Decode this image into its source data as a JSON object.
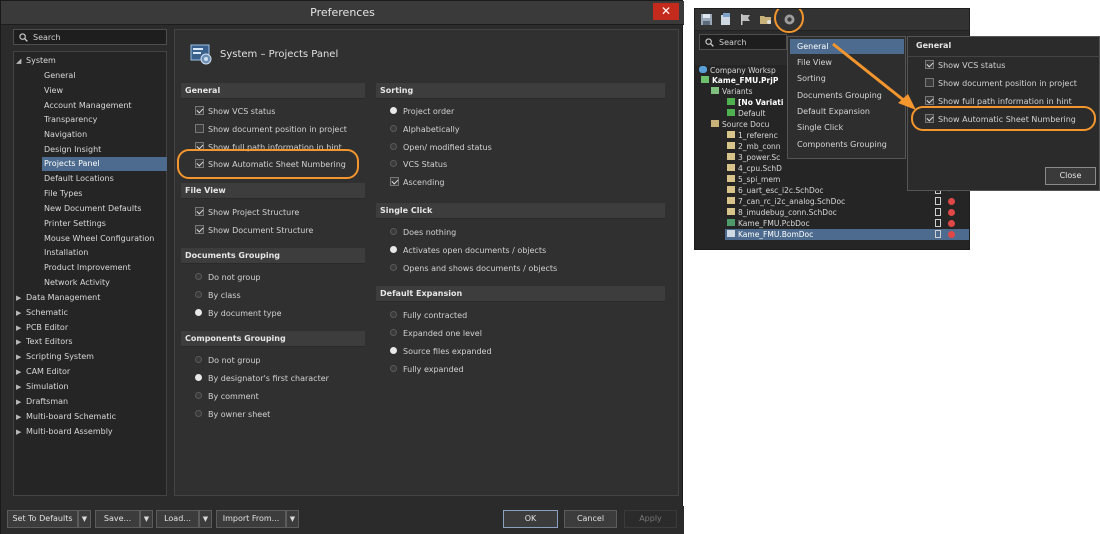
{
  "window": {
    "title": "Preferences",
    "close_glyph": "✕"
  },
  "search": {
    "placeholder": "Search",
    "icon": "search-icon"
  },
  "tree": [
    {
      "label": "System",
      "expanded": true,
      "level": 0
    },
    {
      "label": "General",
      "level": 1
    },
    {
      "label": "View",
      "level": 1
    },
    {
      "label": "Account Management",
      "level": 1
    },
    {
      "label": "Transparency",
      "level": 1
    },
    {
      "label": "Navigation",
      "level": 1
    },
    {
      "label": "Design Insight",
      "level": 1
    },
    {
      "label": "Projects Panel",
      "level": 1,
      "selected": true
    },
    {
      "label": "Default Locations",
      "level": 1
    },
    {
      "label": "File Types",
      "level": 1
    },
    {
      "label": "New Document Defaults",
      "level": 1
    },
    {
      "label": "Printer Settings",
      "level": 1
    },
    {
      "label": "Mouse Wheel Configuration",
      "level": 1
    },
    {
      "label": "Installation",
      "level": 1
    },
    {
      "label": "Product Improvement",
      "level": 1
    },
    {
      "label": "Network Activity",
      "level": 1
    },
    {
      "label": "Data Management",
      "level": 0
    },
    {
      "label": "Schematic",
      "level": 0
    },
    {
      "label": "PCB Editor",
      "level": 0
    },
    {
      "label": "Text Editors",
      "level": 0
    },
    {
      "label": "Scripting System",
      "level": 0
    },
    {
      "label": "CAM Editor",
      "level": 0
    },
    {
      "label": "Simulation",
      "level": 0
    },
    {
      "label": "Draftsman",
      "level": 0
    },
    {
      "label": "Multi-board Schematic",
      "level": 0
    },
    {
      "label": "Multi-board Assembly",
      "level": 0
    }
  ],
  "page": {
    "title": "System – Projects Panel",
    "general": {
      "header": "General",
      "options": [
        {
          "label": "Show VCS status",
          "checked": true
        },
        {
          "label": "Show document position in project",
          "checked": false
        },
        {
          "label": "Show full path information in hint",
          "checked": true
        },
        {
          "label": "Show Automatic Sheet Numbering",
          "checked": true
        }
      ]
    },
    "file_view": {
      "header": "File View",
      "options": [
        {
          "label": "Show Project Structure",
          "checked": true
        },
        {
          "label": "Show Document Structure",
          "checked": true
        }
      ]
    },
    "documents_grouping": {
      "header": "Documents Grouping",
      "options": [
        {
          "label": "Do not group",
          "selected": false
        },
        {
          "label": "By class",
          "selected": false
        },
        {
          "label": "By document type",
          "selected": true
        }
      ]
    },
    "components_grouping": {
      "header": "Components Grouping",
      "options": [
        {
          "label": "Do not group",
          "selected": false
        },
        {
          "label": "By designator's first character",
          "selected": true
        },
        {
          "label": "By comment",
          "selected": false
        },
        {
          "label": "By owner sheet",
          "selected": false
        }
      ]
    },
    "sorting": {
      "header": "Sorting",
      "options": [
        {
          "label": "Project order",
          "type": "radio",
          "on": true
        },
        {
          "label": "Alphabetically",
          "type": "radio",
          "on": false
        },
        {
          "label": "Open/ modified status",
          "type": "radio",
          "on": false
        },
        {
          "label": "VCS Status",
          "type": "radio",
          "on": false
        },
        {
          "label": "Ascending",
          "type": "check",
          "on": true
        }
      ]
    },
    "single_click": {
      "header": "Single Click",
      "options": [
        {
          "label": "Does nothing",
          "selected": false
        },
        {
          "label": "Activates open documents / objects",
          "selected": true
        },
        {
          "label": "Opens and shows documents / objects",
          "selected": false
        }
      ]
    },
    "default_expansion": {
      "header": "Default Expansion",
      "options": [
        {
          "label": "Fully contracted",
          "selected": false
        },
        {
          "label": "Expanded one level",
          "selected": false
        },
        {
          "label": "Source files expanded",
          "selected": true
        },
        {
          "label": "Fully expanded",
          "selected": false
        }
      ]
    }
  },
  "buttons": {
    "set_defaults": "Set To Defaults",
    "save": "Save...",
    "load": "Load...",
    "import_from": "Import From...",
    "ok": "OK",
    "cancel": "Cancel",
    "apply": "Apply",
    "dropdown_glyph": "▼"
  },
  "panel": {
    "search_placeholder": "Search",
    "tree": [
      {
        "label": "Company Worksp",
        "bold": false
      },
      {
        "label": "Kame_FMU.PrjP",
        "bold": true
      },
      {
        "label": "Variants",
        "bold": false
      },
      {
        "label": "[No Variati",
        "bold": true
      },
      {
        "label": "Default",
        "bold": false
      },
      {
        "label": "Source Docu",
        "bold": false
      },
      {
        "label": "1_referenc",
        "bold": false
      },
      {
        "label": "2_mb_conn",
        "bold": false
      },
      {
        "label": "3_power.Sc",
        "bold": false
      },
      {
        "label": "4_cpu.SchD",
        "bold": false
      },
      {
        "label": "5_spi_mem",
        "bold": false
      },
      {
        "label": "6_uart_esc_i2c.SchDoc",
        "bold": false,
        "status": "ok"
      },
      {
        "label": "7_can_rc_i2c_analog.SchDoc",
        "bold": false,
        "status": "err"
      },
      {
        "label": "8_imudebug_conn.SchDoc",
        "bold": false,
        "status": "err"
      },
      {
        "label": "Kame_FMU.PcbDoc",
        "bold": false,
        "status": "err"
      },
      {
        "label": "Kame_FMU.BomDoc",
        "bold": false,
        "status": "err",
        "selected": true
      }
    ],
    "ok_glyph": "✔",
    "menu": [
      {
        "label": "General",
        "active": true
      },
      {
        "label": "File View"
      },
      {
        "label": "Sorting"
      },
      {
        "label": "Documents Grouping"
      },
      {
        "label": "Default Expansion"
      },
      {
        "label": "Single Click"
      },
      {
        "label": "Components Grouping"
      }
    ],
    "popup": {
      "header": "General",
      "options": [
        {
          "label": "Show VCS status",
          "checked": true
        },
        {
          "label": "Show document position in project",
          "checked": false
        },
        {
          "label": "Show full path information in hint",
          "checked": true
        },
        {
          "label": "Show Automatic Sheet Numbering",
          "checked": true
        }
      ],
      "close": "Close"
    }
  },
  "colors": {
    "accent": "#f2962d",
    "selection": "#4c6b8e",
    "window_bg": "#2b2b2b"
  }
}
